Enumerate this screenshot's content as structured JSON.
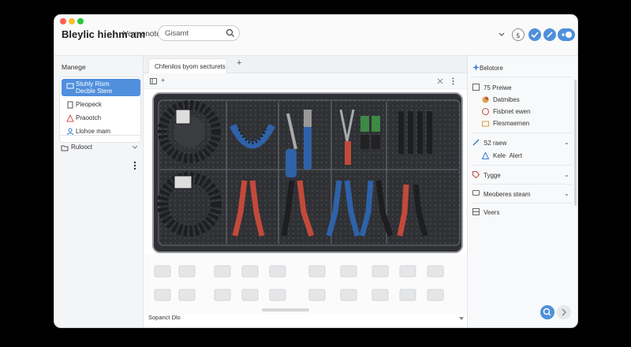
{
  "window": {
    "app_title": "Bleylic hiehm am",
    "app_subtitle": "Ve monotets",
    "search_placeholder": "Gisamt"
  },
  "sidebar": {
    "header": "Manege",
    "items": [
      {
        "label": "Stuhly Rism",
        "sublabel": "Decble Stere",
        "active": true
      },
      {
        "label": "Pleopeck",
        "active": false
      },
      {
        "label": "Praootch",
        "active": false
      },
      {
        "label": "Llohoe mam",
        "active": false
      }
    ],
    "section_label": "Rulooct"
  },
  "main": {
    "tab_label": "Chfenilos byom secturets",
    "add_tab": "+",
    "footer_label": "Sopanct Dlo"
  },
  "right_panel": {
    "title": "Belotore",
    "sections": [
      {
        "label": "75 Preiwe",
        "children": [
          "Datmibes",
          "Fisbnet ewen",
          "Flesmaemen"
        ]
      },
      {
        "label": "S2 raew",
        "children": [
          "Kele",
          "Alert"
        ]
      },
      {
        "label": "Tygge",
        "children": []
      },
      {
        "label": "Meoberes steam",
        "children": []
      },
      {
        "label": "Veers",
        "children": []
      }
    ]
  },
  "colors": {
    "accent": "#4f8fdc",
    "red_dot": "#ff5f57",
    "yellow_dot": "#febc2e",
    "green_dot": "#28c840"
  }
}
